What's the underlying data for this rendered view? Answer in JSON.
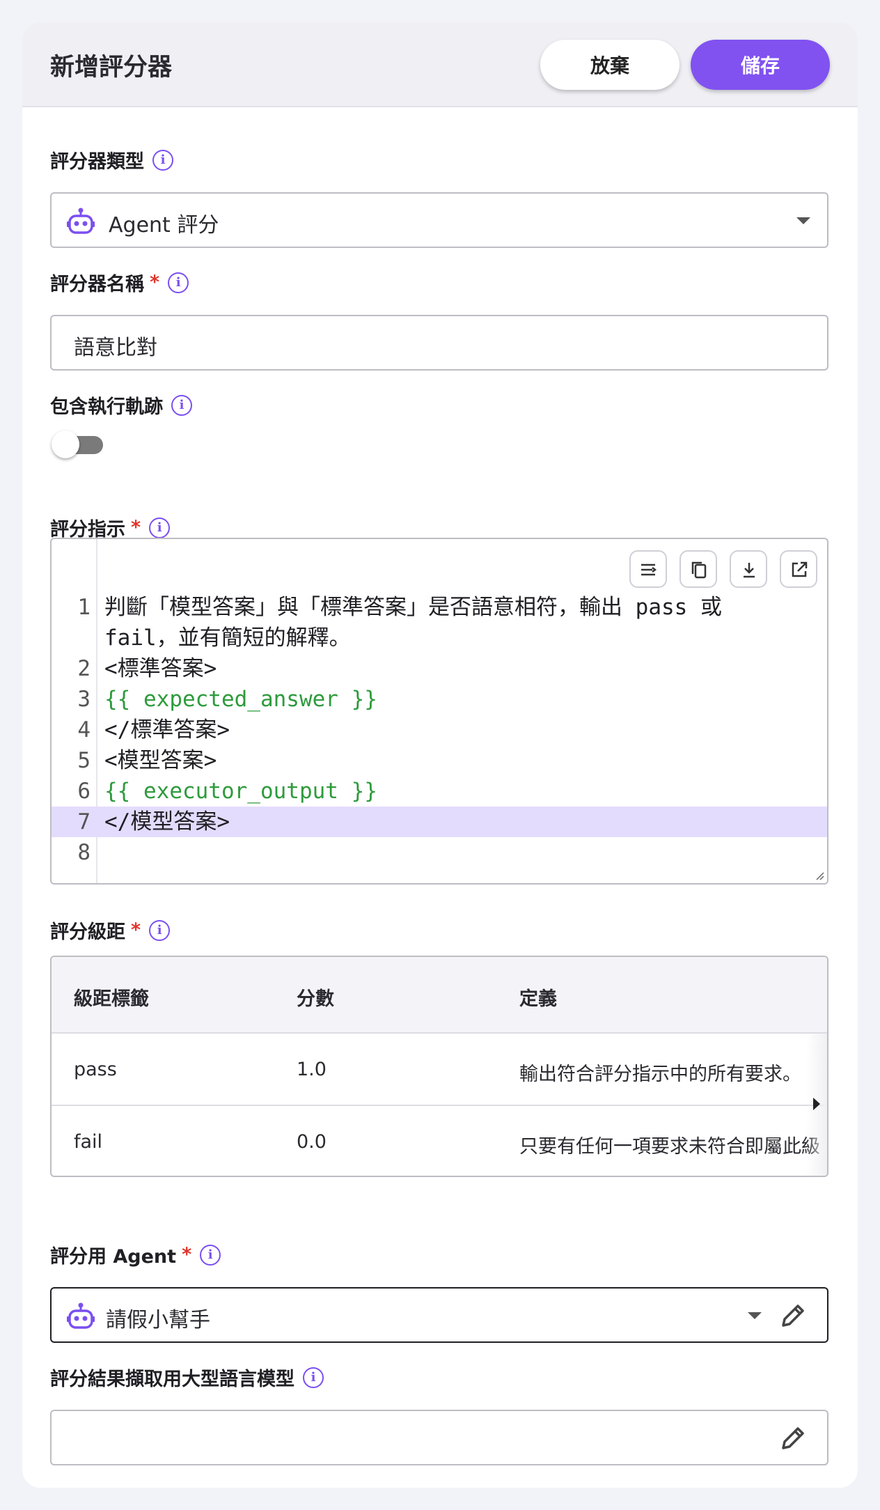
{
  "header": {
    "title": "新增評分器",
    "cancel_label": "放棄",
    "save_label": "儲存"
  },
  "grader_type": {
    "label": "評分器類型",
    "value": "Agent 評分",
    "icon": "robot-icon"
  },
  "grader_name": {
    "label": "評分器名稱",
    "required_mark": "*",
    "value": "語意比對"
  },
  "include_trace": {
    "label": "包含執行軌跡",
    "enabled": false
  },
  "instructions": {
    "label": "評分指示",
    "required_mark": "*",
    "toolbar": [
      "wrap-lines-icon",
      "copy-icon",
      "download-icon",
      "open-external-icon"
    ],
    "lines": [
      {
        "number": "1",
        "text": "判斷「模型答案」與「標準答案」是否語意相符，輸出 pass 或"
      },
      {
        "number": "",
        "text": "fail，並有簡短的解釋。"
      },
      {
        "number": "2",
        "text": "<標準答案>"
      },
      {
        "number": "3",
        "text": "{{ expected_answer }}"
      },
      {
        "number": "4",
        "text": "</標準答案>"
      },
      {
        "number": "5",
        "text": "<模型答案>"
      },
      {
        "number": "6",
        "text": "{{ executor_output }}"
      },
      {
        "number": "7",
        "text": "</模型答案>"
      },
      {
        "number": "8",
        "text": ""
      }
    ],
    "highlighted_line": "7",
    "variable_color": "#2e9b3c"
  },
  "scale": {
    "label": "評分級距",
    "required_mark": "*",
    "columns": [
      "級距標籤",
      "分數",
      "定義"
    ],
    "rows": [
      {
        "tag": "pass",
        "score": "1.0",
        "definition": "輸出符合評分指示中的所有要求。"
      },
      {
        "tag": "fail",
        "score": "0.0",
        "definition": "只要有任何一項要求未符合即屬此級"
      }
    ]
  },
  "agent": {
    "label": "評分用 Agent",
    "required_mark": "*",
    "value": "請假小幫手",
    "icon": "robot-icon"
  },
  "llm": {
    "label": "評分結果擷取用大型語言模型",
    "value": ""
  },
  "colors": {
    "accent": "#8152f0",
    "required": "#e0342a",
    "highlight": "#e4dcfd"
  }
}
